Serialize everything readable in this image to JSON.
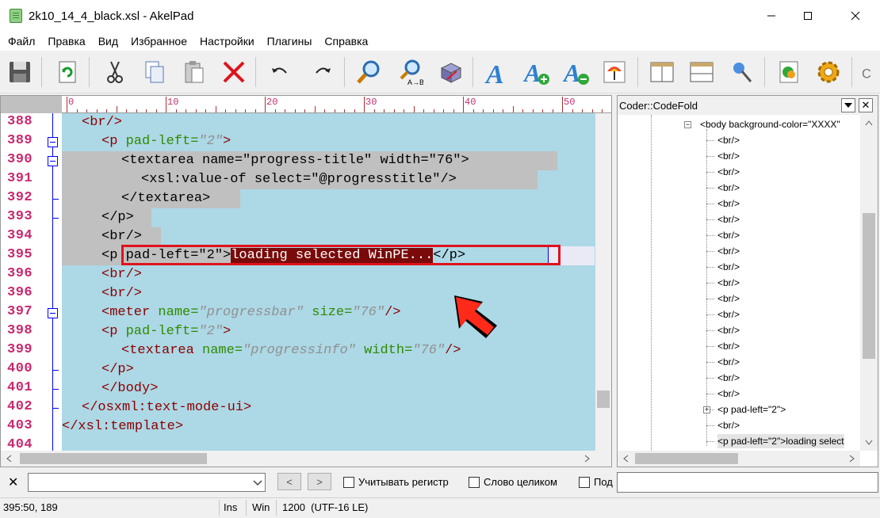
{
  "window": {
    "title": "2k10_14_4_black.xsl - AkelPad"
  },
  "menu": [
    "Файл",
    "Правка",
    "Вид",
    "Избранное",
    "Настройки",
    "Плагины",
    "Справка"
  ],
  "toolbar": {
    "icons": [
      "save-icon",
      "reload-icon",
      "cut-icon",
      "copy-icon",
      "paste-icon",
      "delete-icon",
      "undo-icon",
      "redo-icon",
      "find-icon",
      "replace-icon",
      "goto-icon",
      "font-icon",
      "font-increase-icon",
      "font-decrease-icon",
      "color-icon",
      "split-window-icon",
      "split-horizontal-icon",
      "pin-icon",
      "plugin-icon",
      "settings-gear-icon",
      "more-icon"
    ],
    "replace_sub": "A→B"
  },
  "ruler": {
    "labels": [
      "0",
      "10",
      "20",
      "30",
      "40",
      "50"
    ]
  },
  "editor": {
    "line_numbers": [
      "388",
      "389",
      "390",
      "391",
      "392",
      "393",
      "394",
      "395",
      "396",
      "396",
      "397",
      "398",
      "399",
      "400",
      "401",
      "402",
      "403",
      "404"
    ],
    "lines": {
      "l388": "<br/>",
      "l389_tag": "<p",
      "l389_attr": " pad-left=",
      "l389_val": "\"2\"",
      "l389_end": ">",
      "l390": "<textarea name=\"progress-title\" width=\"76\">",
      "l391": "<xsl:value-of select=\"@progresstitle\"/>",
      "l392": "</textarea>",
      "l393": "</p>",
      "l394": "<br/>",
      "l395_pre": "<p pad-left=\"2\">",
      "l395_hl": "loading selected WinPE...",
      "l395_post": "</p>",
      "l396a": "<br/>",
      "l396b": "<br/>",
      "l397_tag": "<meter",
      "l397_attr1": " name=",
      "l397_val1": "\"progressbar\"",
      "l397_attr2": " size=",
      "l397_val2": "\"76\"",
      "l397_end": "/>",
      "l398_tag": "<p",
      "l398_attr": " pad-left=",
      "l398_val": "\"2\"",
      "l398_end": ">",
      "l399_tag": "<textarea",
      "l399_attr1": " name=",
      "l399_val1": "\"progressinfo\"",
      "l399_attr2": " width=",
      "l399_val2": "\"76\"",
      "l399_end": "/>",
      "l400": "</p>",
      "l401": "</body>",
      "l402": "</osxml:text-mode-ui>",
      "l403": "</xsl:template>"
    }
  },
  "panel": {
    "title": "Coder::CodeFold",
    "tree": {
      "body_node": "<body background-color=\"XXXX\"",
      "br": "<br/>",
      "p_node": "<p pad-left=\"2\">",
      "p_loading": "<p pad-left=\"2\">loading select"
    }
  },
  "findbar": {
    "case_label": "Учитывать регистр",
    "whole_label": "Слово целиком",
    "next_label": "Под",
    "prev_btn": "<",
    "next_btn": ">"
  },
  "status": {
    "position": "395:50, 189",
    "mode": "Ins",
    "eol": "Win",
    "encoding": "1200  (UTF-16 LE)"
  },
  "colors": {
    "editor_bg": "#add8e6",
    "tag": "#8b0000",
    "attr": "#2e8b00",
    "value": "#909090",
    "line_number": "#c8286e",
    "highlight_box": "#e0121c",
    "selected_text_bg": "#7a0a0a"
  }
}
